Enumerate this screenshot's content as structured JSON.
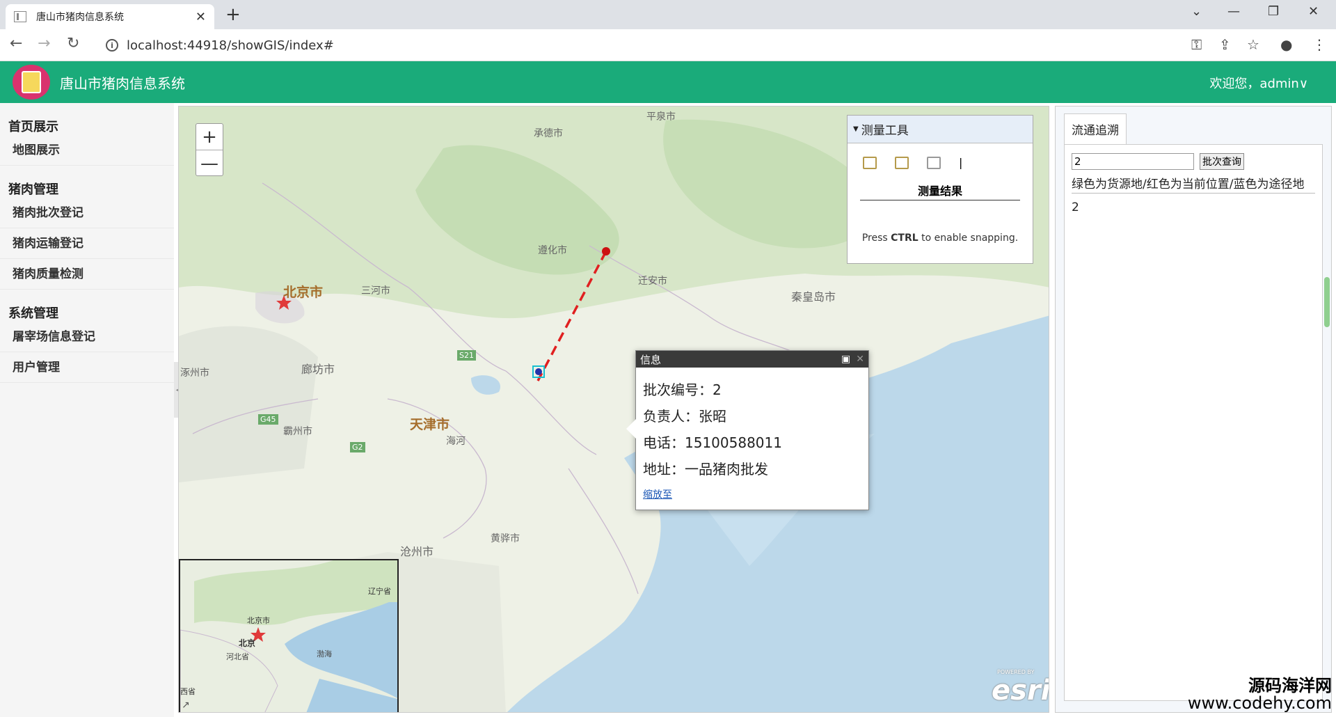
{
  "browser": {
    "tab_title": "唐山市猪肉信息系统",
    "tab_close": "✕",
    "new_tab": "+",
    "url": "localhost:44918/showGIS/index#",
    "back": "←",
    "forward": "→",
    "reload": "↻",
    "win_list": "⌄",
    "win_min": "—",
    "win_max": "❐",
    "win_close": "✕"
  },
  "header": {
    "title": "唐山市猪肉信息系统",
    "user": "欢迎您，admin∨"
  },
  "sidebar": {
    "groups": [
      {
        "title": "首页展示",
        "items": [
          "地图展示"
        ]
      },
      {
        "title": "猪肉管理",
        "items": [
          "猪肉批次登记",
          "猪肉运输登记",
          "猪肉质量检测"
        ]
      },
      {
        "title": "系统管理",
        "items": [
          "屠宰场信息登记",
          "用户管理"
        ]
      }
    ]
  },
  "map": {
    "zoom_in": "+",
    "zoom_out": "—",
    "labels": {
      "pingquan": "平泉市",
      "chengde": "承德市",
      "zunhua": "遵化市",
      "qianan": "迁安市",
      "beijing": "北京市",
      "sanhe": "三河市",
      "qinhuangdao": "秦皇岛市",
      "langfang": "廊坊市",
      "zhuozhou": "涿州市",
      "tianjin": "天津市",
      "bazhou": "霸州市",
      "haihe": "海河",
      "huanghua": "黄骅市",
      "cangzhou": "沧州市",
      "road_s21": "S21",
      "road_g45": "G45",
      "road_g2": "G2"
    },
    "overview_labels": {
      "beijing_city": "北京市",
      "beijing": "北京",
      "hebei": "河北省",
      "bohai": "渤海",
      "liaoning": "辽宁省",
      "shanxi": "西省"
    },
    "esri": "esri",
    "esri_powered": "POWERED BY"
  },
  "measure": {
    "title": "测量工具",
    "result_label": "测量结果",
    "hint_pre": "Press ",
    "hint_key": "CTRL",
    "hint_post": " to enable snapping."
  },
  "popup": {
    "title": "信息",
    "batch": "批次编号：2",
    "owner": "负责人：张昭",
    "phone": "电话：15100588011",
    "address": "地址：一品猪肉批发",
    "zoom_link": "缩放至"
  },
  "trace": {
    "tab": "流通追溯",
    "input_value": "2",
    "button": "批次查询",
    "legend": "绿色为货源地/红色为当前位置/蓝色为途径地",
    "result": "2"
  },
  "watermark": {
    "line1": "源码海洋网",
    "line2": "www.codehy.com"
  },
  "colors": {
    "header_bg": "#1aab7a",
    "route": "#e02020",
    "current": "#cc1111",
    "waypoint": "#2233aa"
  }
}
